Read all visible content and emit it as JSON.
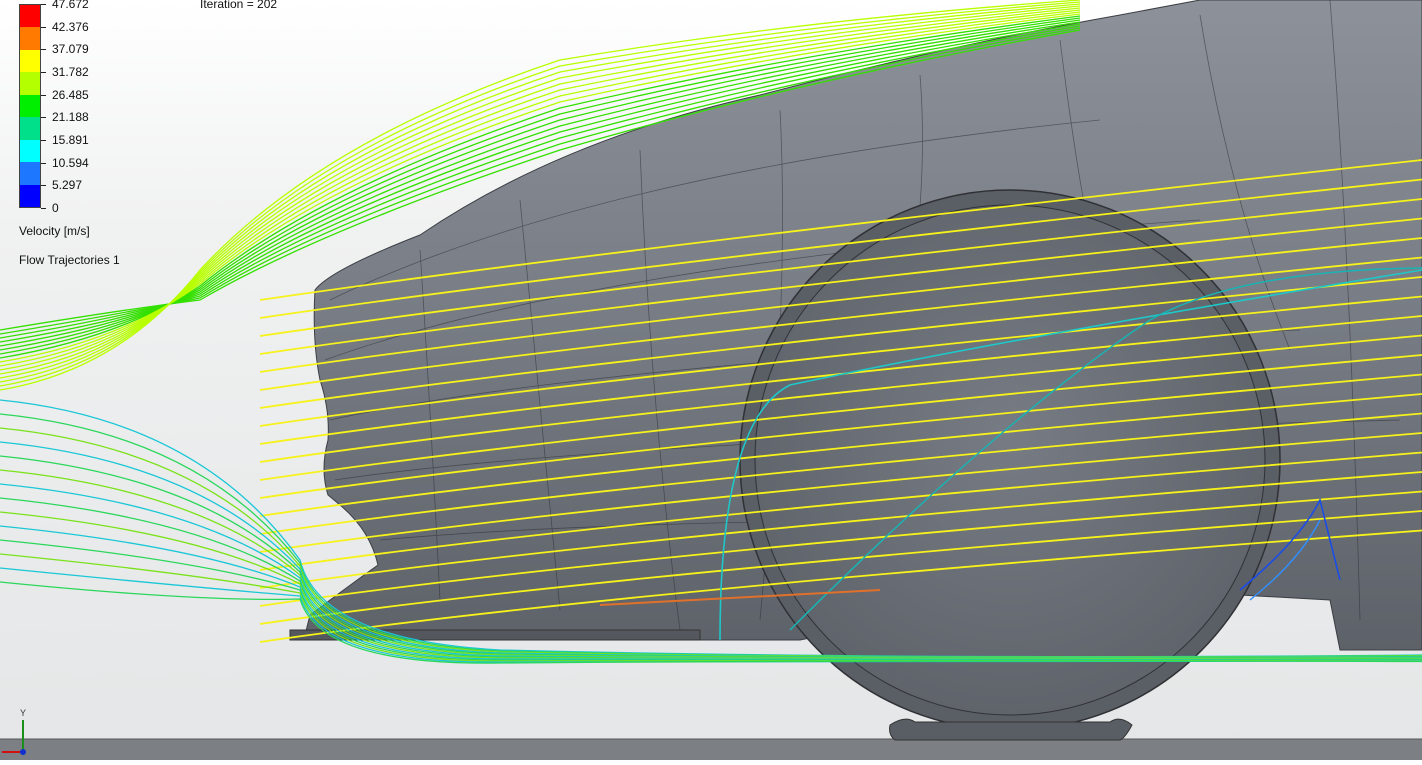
{
  "legend": {
    "ticks": [
      "47.672",
      "42.376",
      "37.079",
      "31.782",
      "26.485",
      "21.188",
      "15.891",
      "10.594",
      "5.297",
      "0"
    ],
    "colors": [
      "#ff0000",
      "#ff7a00",
      "#ffff00",
      "#b4ff00",
      "#00ee00",
      "#00e08a",
      "#00ffff",
      "#1e78ff",
      "#0000ff"
    ],
    "title": "Velocity [m/s]",
    "object": "Flow Trajectories 1"
  },
  "iteration": "Iteration = 202",
  "triad": {
    "y_label": "Y"
  },
  "scene": {
    "body_color": "#6e737b",
    "ground_color": "#a9acaf"
  }
}
